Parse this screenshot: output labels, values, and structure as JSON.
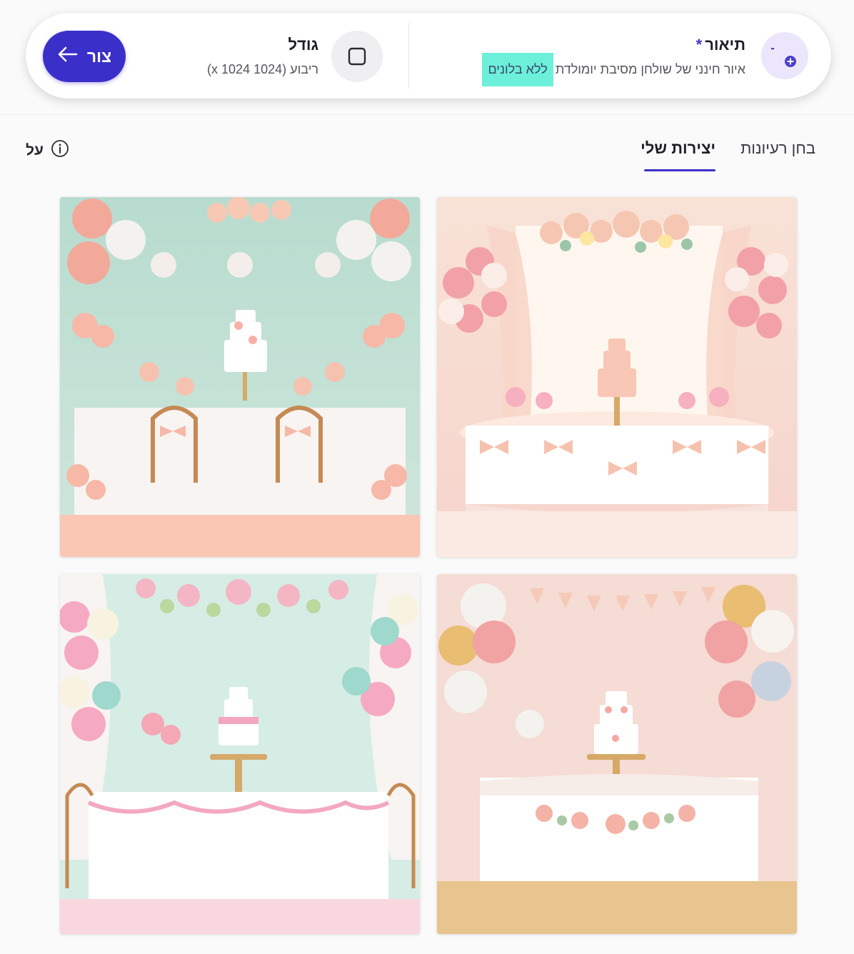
{
  "prompt": {
    "description_label": "תיאור",
    "required_mark": "*",
    "description_text": "איור חינני של שולחן מסיבת יומולדת",
    "description_highlight": "ללא בלונים",
    "size_label": "גודל",
    "size_value": "ריבוע (1024 x 1024)",
    "draw_button_label": "צור",
    "accent_color": "#3b2fc9",
    "highlight_color": "#6cf0da"
  },
  "tabs": {
    "ideas_label": "בחן רעיונות",
    "mine_label": "יצירות שלי",
    "active": "mine"
  },
  "about_label": "על",
  "icons": {
    "description": "text-add-icon",
    "size": "square-icon",
    "draw": "arrow-left-icon",
    "about": "info-icon"
  }
}
